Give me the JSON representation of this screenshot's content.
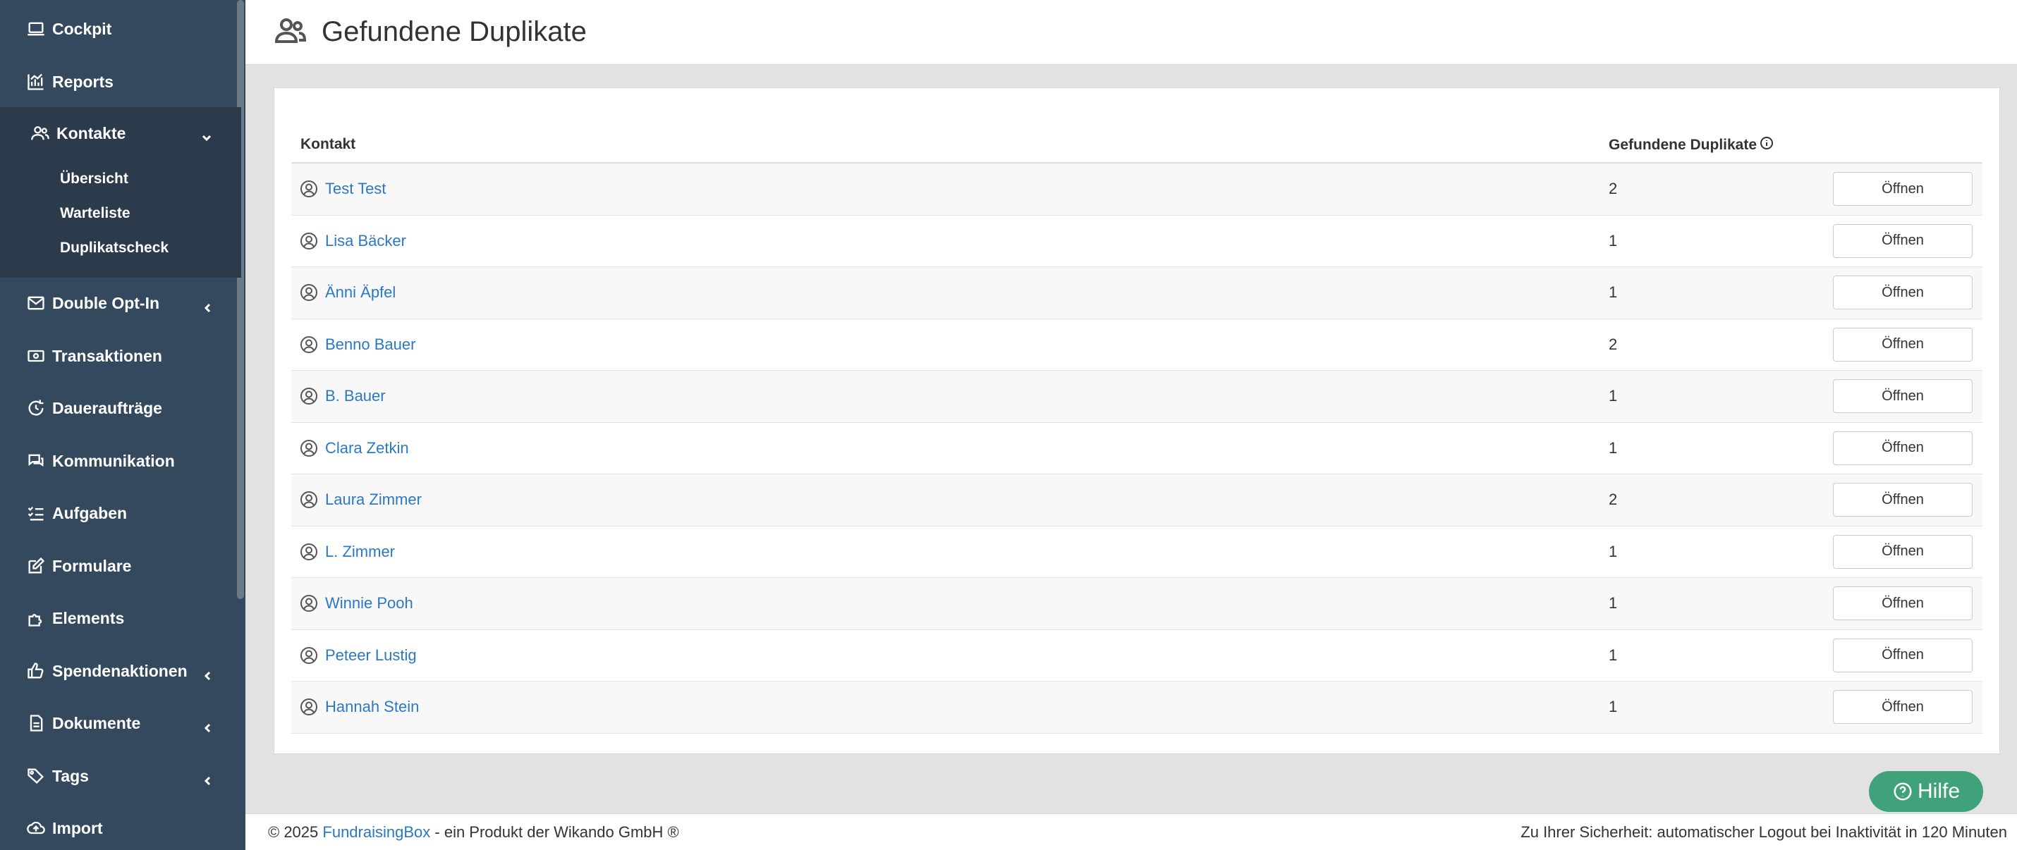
{
  "sidebar": {
    "items": [
      {
        "label": "Cockpit",
        "icon": "laptop-icon"
      },
      {
        "label": "Reports",
        "icon": "chart-icon"
      },
      {
        "label": "Kontakte",
        "icon": "users-icon"
      },
      {
        "label": "Double Opt-In",
        "icon": "envelope-icon"
      },
      {
        "label": "Transaktionen",
        "icon": "money-icon"
      },
      {
        "label": "Daueraufträge",
        "icon": "recurring-icon"
      },
      {
        "label": "Kommunikation",
        "icon": "chat-icon"
      },
      {
        "label": "Aufgaben",
        "icon": "tasks-icon"
      },
      {
        "label": "Formulare",
        "icon": "edit-icon"
      },
      {
        "label": "Elements",
        "icon": "puzzle-icon"
      },
      {
        "label": "Spendenaktionen",
        "icon": "thumbs-up-icon"
      },
      {
        "label": "Dokumente",
        "icon": "document-icon"
      },
      {
        "label": "Tags",
        "icon": "tags-icon"
      },
      {
        "label": "Import",
        "icon": "cloud-upload-icon"
      }
    ],
    "kontakte_sub": [
      "Übersicht",
      "Warteliste",
      "Duplikatscheck"
    ]
  },
  "header": {
    "title": "Gefundene Duplikate"
  },
  "table": {
    "col_contact": "Kontakt",
    "col_duplicates": "Gefundene Duplikate",
    "button_label": "Öffnen",
    "rows": [
      {
        "name": "Test Test",
        "count": "2"
      },
      {
        "name": "Lisa Bäcker",
        "count": "1"
      },
      {
        "name": "Änni Äpfel",
        "count": "1"
      },
      {
        "name": "Benno Bauer",
        "count": "2"
      },
      {
        "name": "B. Bauer",
        "count": "1"
      },
      {
        "name": "Clara Zetkin",
        "count": "1"
      },
      {
        "name": "Laura Zimmer",
        "count": "2"
      },
      {
        "name": "L. Zimmer",
        "count": "1"
      },
      {
        "name": "Winnie Pooh",
        "count": "1"
      },
      {
        "name": "Peteer Lustig",
        "count": "1"
      },
      {
        "name": "Hannah Stein",
        "count": "1"
      }
    ]
  },
  "help": {
    "label": "Hilfe"
  },
  "footer": {
    "copyright": "© 2025",
    "brand": "FundraisingBox",
    "suffix": "- ein Produkt der Wikando GmbH ®",
    "security_note": "Zu Ihrer Sicherheit: automatischer Logout bei Inaktivität in 120 Minuten"
  },
  "colors": {
    "sidebar": "#34495e",
    "link": "#2b78c5",
    "help": "#3fa27b"
  }
}
